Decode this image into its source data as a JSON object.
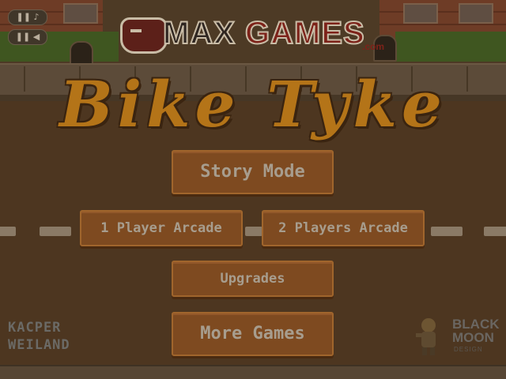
{
  "sound_controls": {
    "music_icon": "music-note-icon",
    "sfx_icon": "speaker-icon",
    "music_glyph": "❚❚ ♪",
    "sfx_glyph": "❚❚ ◀"
  },
  "sponsor": {
    "part1": "MAX",
    "part2": "GAMES",
    "suffix": ".com"
  },
  "title": "Bike Tyke",
  "menu": {
    "story_mode": "Story Mode",
    "one_player": "1 Player Arcade",
    "two_players": "2 Players Arcade",
    "upgrades": "Upgrades",
    "more_games": "More Games"
  },
  "credits": {
    "left_line1": "KACPER",
    "left_line2": "WEILAND",
    "right_line1": "BLACK",
    "right_line2": "MOON",
    "right_sub": "DESIGN"
  },
  "colors": {
    "button_fill": "#7e4a20",
    "title_color": "#b47418",
    "road": "#4d3620"
  }
}
